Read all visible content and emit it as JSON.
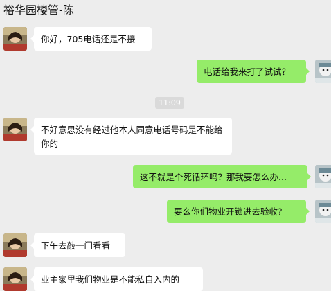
{
  "header": {
    "title": "裕华园楼管-陈"
  },
  "timestamp": "11:09",
  "messages": [
    {
      "side": "left",
      "text": "你好，705电话还是不接"
    },
    {
      "side": "right",
      "text": "电话给我来打了试试？"
    },
    {
      "side": "left",
      "text": "不好意思没有经过他本人同意电话号码是不能给你的"
    },
    {
      "side": "right",
      "text": "这不就是个死循环吗？那我要怎么办..."
    },
    {
      "side": "right",
      "text": "要么你们物业开锁进去验收？"
    },
    {
      "side": "left",
      "text": "下午去敲一门看看"
    },
    {
      "side": "left",
      "text": "业主家里我们物业是不能私自入内的"
    }
  ]
}
